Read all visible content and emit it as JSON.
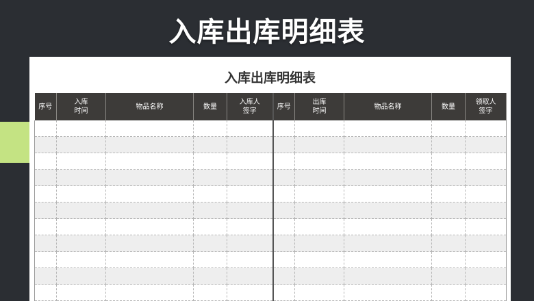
{
  "page_title": "入库出库明细表",
  "sheet_title": "入库出库明细表",
  "colors": {
    "background": "#2b2e33",
    "accent": "#c4e383",
    "header": "#3d3b39",
    "row_alt": "#eeeeee"
  },
  "inbound_headers": [
    "序号",
    "入库\n时间",
    "物品名称",
    "数量",
    "入库人\n签字"
  ],
  "outbound_headers": [
    "序号",
    "出库\n时间",
    "物品名称",
    "数量",
    "领取人\n签字"
  ],
  "row_count": 11
}
